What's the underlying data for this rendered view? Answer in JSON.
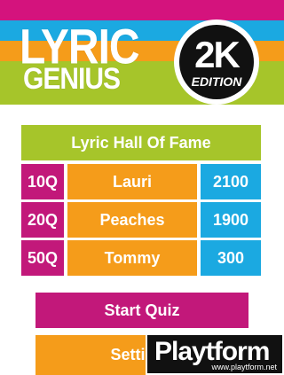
{
  "logo": {
    "line1": "LYRIC",
    "line2": "GENIUS",
    "badge_big": "2K",
    "badge_small": "EDITION"
  },
  "hall_of_fame": {
    "title": "Lyric Hall Of Fame",
    "rows": [
      {
        "quiz": "10Q",
        "name": "Lauri",
        "score": "2100"
      },
      {
        "quiz": "20Q",
        "name": "Peaches",
        "score": "1900"
      },
      {
        "quiz": "50Q",
        "name": "Tommy",
        "score": "300"
      }
    ]
  },
  "buttons": {
    "start": "Start Quiz",
    "settings": "Settings"
  },
  "watermark": {
    "text": "Playtform",
    "url": "www.playtform.net"
  },
  "colors": {
    "magenta": "#c2187a",
    "cyan": "#1ba9e1",
    "orange": "#f59c1a",
    "green": "#a6c52a"
  }
}
